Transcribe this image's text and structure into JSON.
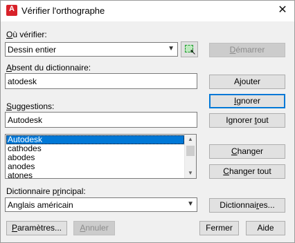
{
  "window": {
    "title": "Vérifier l'orthographe",
    "app_icon_letter": "A",
    "close_glyph": "✕"
  },
  "where": {
    "label_mnemonic": "O",
    "label_rest": "ù vérifier:",
    "value": "Dessin entier",
    "start_mnemonic": "D",
    "start_rest": "émarrer"
  },
  "not_in_dict": {
    "label_mnemonic": "A",
    "label_rest": "bsent du dictionnaire:",
    "value": "atodesk"
  },
  "suggestions": {
    "label_mnemonic": "S",
    "label_rest": "uggestions:",
    "value": "Autodesk",
    "items": [
      "Autodesk",
      "cathodes",
      "abodes",
      "anodes",
      "atones"
    ],
    "selected_index": 0
  },
  "buttons": {
    "add_pre": "A",
    "add_mnemonic": "j",
    "add_rest": "outer",
    "ignore_mnemonic": "I",
    "ignore_rest": "gnorer",
    "ignore_all_pre": "Ignorer ",
    "ignore_all_mnemonic": "t",
    "ignore_all_rest": "out",
    "change_pre": "",
    "change_mnemonic": "C",
    "change_rest": "hanger",
    "change_all_pre": "",
    "change_all_mnemonic": "C",
    "change_all_rest": "hanger tout",
    "dictionaries_pre": "Dictionnai",
    "dictionaries_mnemonic": "r",
    "dictionaries_rest": "es...",
    "settings_mnemonic": "P",
    "settings_rest": "aramètres...",
    "undo_mnemonic": "A",
    "undo_rest": "nnuler",
    "close": "Fermer",
    "help": "Aide"
  },
  "main_dict": {
    "label_pre": "Dictionnaire p",
    "label_mnemonic": "r",
    "label_rest": "incipal:",
    "value": "Anglais américain"
  },
  "icons": {
    "dropdown": "▼",
    "scroll_up": "▲",
    "scroll_down": "▼",
    "cursor": "↖"
  }
}
